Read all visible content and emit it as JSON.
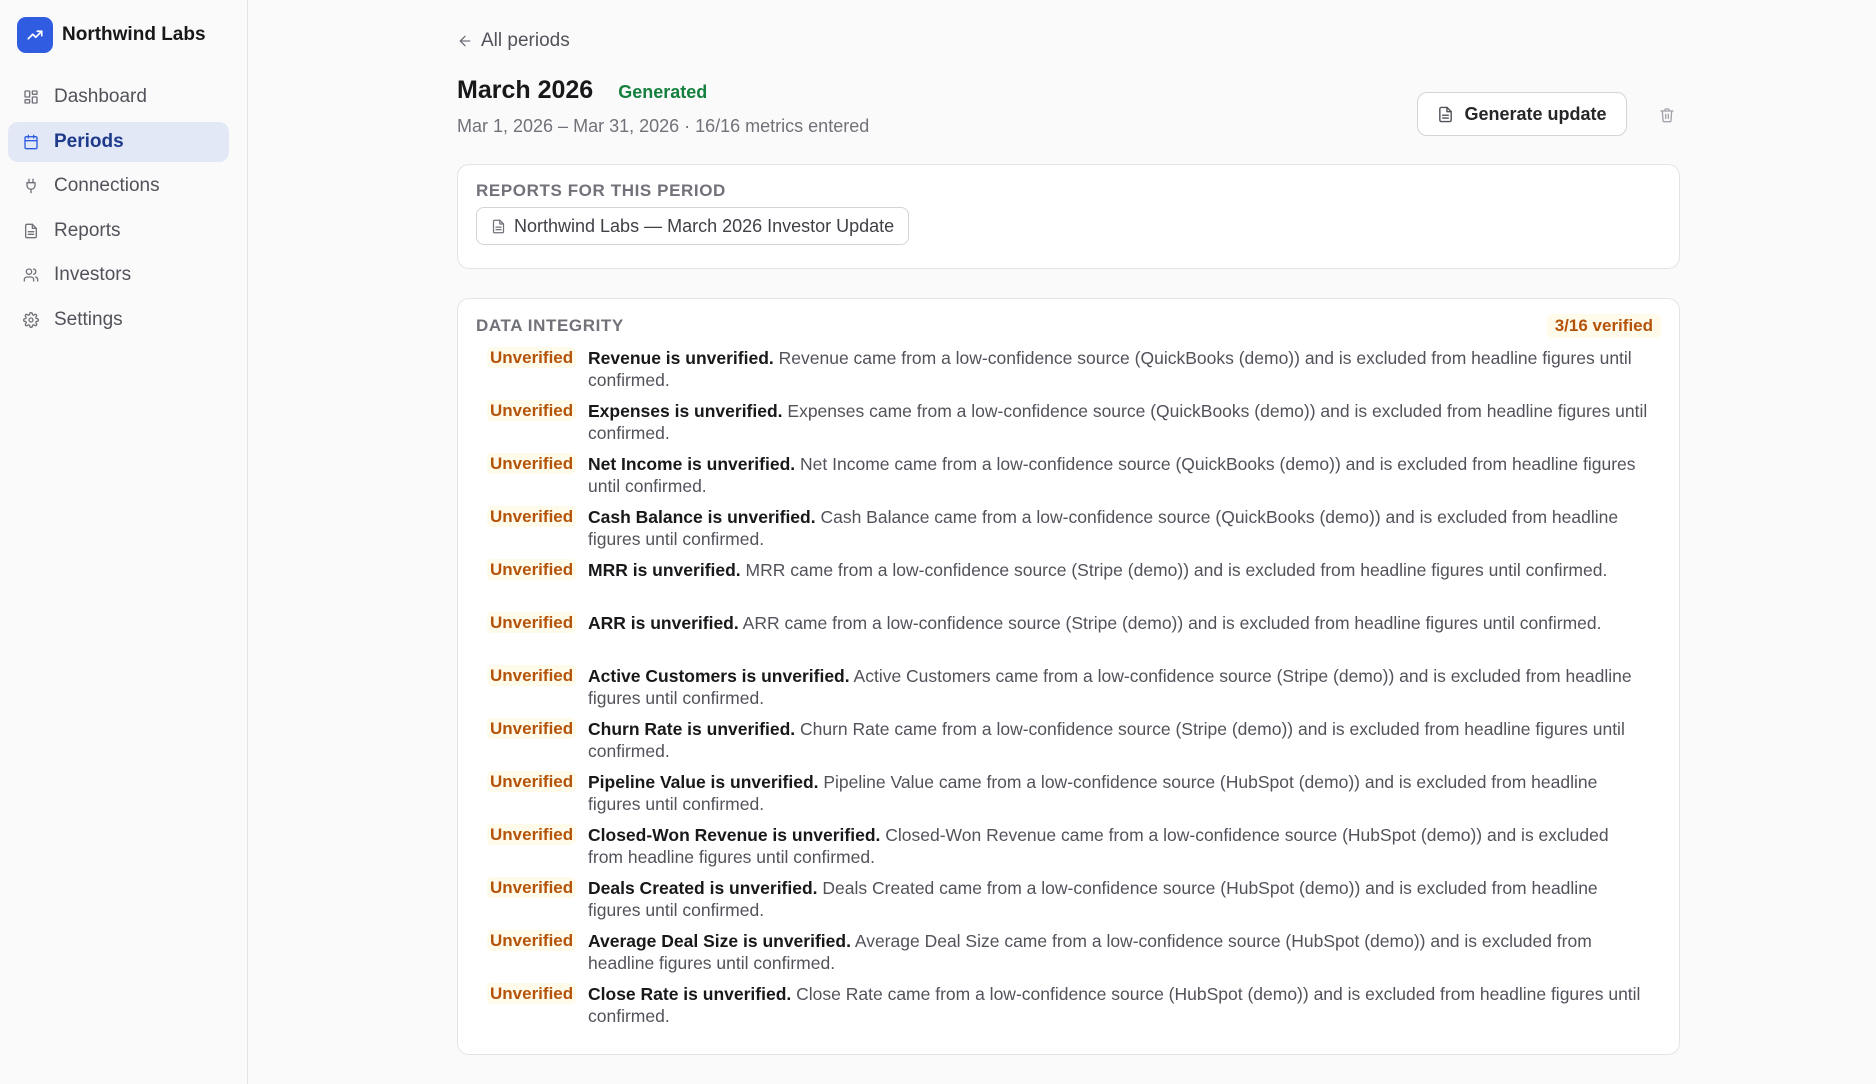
{
  "app": {
    "name": "Northwind Labs",
    "logo_icon": "trend-up-icon",
    "accent_color": "#2f5ce0"
  },
  "sidebar": {
    "items": [
      {
        "label": "Dashboard",
        "icon": "grid-icon",
        "active": false
      },
      {
        "label": "Periods",
        "icon": "calendar-icon",
        "active": true
      },
      {
        "label": "Connections",
        "icon": "plug-icon",
        "active": false
      },
      {
        "label": "Reports",
        "icon": "document-icon",
        "active": false
      },
      {
        "label": "Investors",
        "icon": "users-icon",
        "active": false
      },
      {
        "label": "Settings",
        "icon": "gear-icon",
        "active": false
      }
    ]
  },
  "header": {
    "back_label": "All periods",
    "title": "March 2026",
    "status": "Generated",
    "status_color": "#15803d",
    "subtitle": "Mar 1, 2026 – Mar 31, 2026 · 16/16 metrics entered",
    "generate_label": "Generate update"
  },
  "reports": {
    "heading": "Reports for this period",
    "items": [
      "Northwind Labs — March 2026 Investor Update"
    ]
  },
  "integrity": {
    "heading": "Data integrity",
    "verified_summary": "3/16 verified",
    "warning_color": "#b45309",
    "issues": [
      {
        "badge": "Unverified",
        "title": "Revenue is unverified.",
        "detail": "Revenue came from a low-confidence source (QuickBooks (demo)) and is excluded from headline figures until confirmed."
      },
      {
        "badge": "Unverified",
        "title": "Expenses is unverified.",
        "detail": "Expenses came from a low-confidence source (QuickBooks (demo)) and is excluded from headline figures until confirmed."
      },
      {
        "badge": "Unverified",
        "title": "Net Income is unverified.",
        "detail": "Net Income came from a low-confidence source (QuickBooks (demo)) and is excluded from headline figures until confirmed."
      },
      {
        "badge": "Unverified",
        "title": "Cash Balance is unverified.",
        "detail": "Cash Balance came from a low-confidence source (QuickBooks (demo)) and is excluded from headline figures until confirmed."
      },
      {
        "badge": "Unverified",
        "title": "MRR is unverified.",
        "detail": "MRR came from a low-confidence source (Stripe (demo)) and is excluded from headline figures until confirmed."
      },
      {
        "badge": "Unverified",
        "title": "ARR is unverified.",
        "detail": "ARR came from a low-confidence source (Stripe (demo)) and is excluded from headline figures until confirmed."
      },
      {
        "badge": "Unverified",
        "title": "Active Customers is unverified.",
        "detail": "Active Customers came from a low-confidence source (Stripe (demo)) and is excluded from headline figures until confirmed."
      },
      {
        "badge": "Unverified",
        "title": "Churn Rate is unverified.",
        "detail": "Churn Rate came from a low-confidence source (Stripe (demo)) and is excluded from headline figures until confirmed."
      },
      {
        "badge": "Unverified",
        "title": "Pipeline Value is unverified.",
        "detail": "Pipeline Value came from a low-confidence source (HubSpot (demo)) and is excluded from headline figures until confirmed."
      },
      {
        "badge": "Unverified",
        "title": "Closed-Won Revenue is unverified.",
        "detail": "Closed-Won Revenue came from a low-confidence source (HubSpot (demo)) and is excluded from headline figures until confirmed."
      },
      {
        "badge": "Unverified",
        "title": "Deals Created is unverified.",
        "detail": "Deals Created came from a low-confidence source (HubSpot (demo)) and is excluded from headline figures until confirmed."
      },
      {
        "badge": "Unverified",
        "title": "Average Deal Size is unverified.",
        "detail": "Average Deal Size came from a low-confidence source (HubSpot (demo)) and is excluded from headline figures until confirmed."
      },
      {
        "badge": "Unverified",
        "title": "Close Rate is unverified.",
        "detail": "Close Rate came from a low-confidence source (HubSpot (demo)) and is excluded from headline figures until confirmed."
      }
    ]
  }
}
